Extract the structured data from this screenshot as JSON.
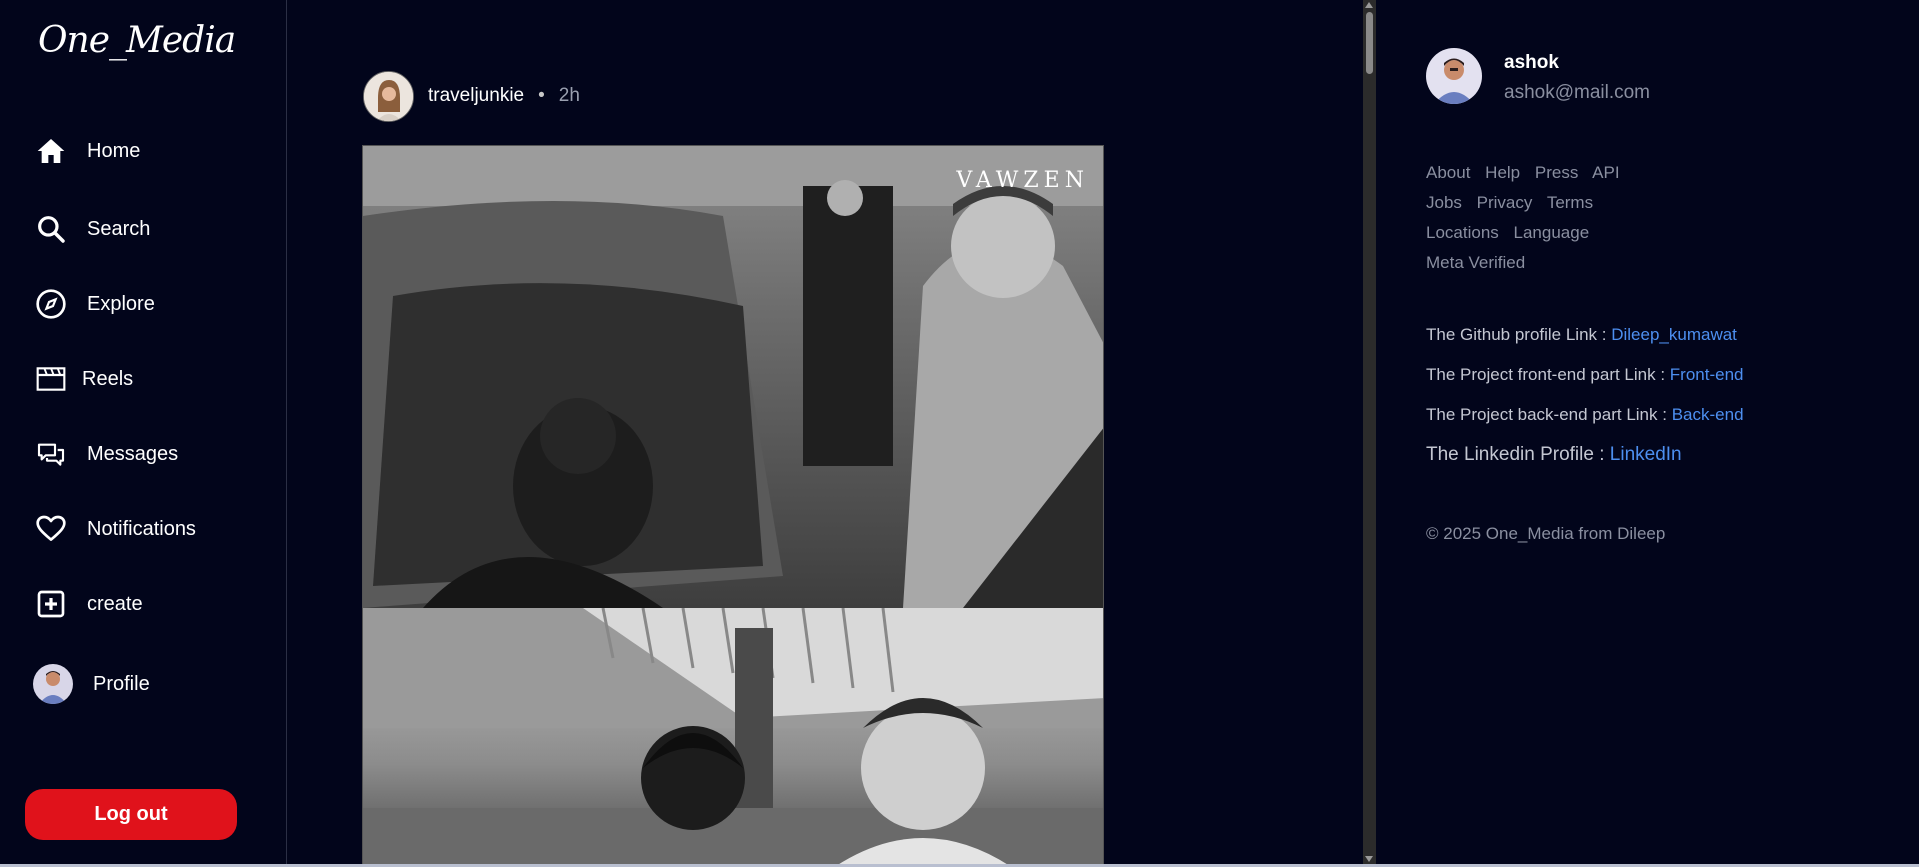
{
  "app": {
    "logo": "One_Media"
  },
  "sidebar": {
    "items": [
      {
        "label": "Home",
        "icon": "home-icon"
      },
      {
        "label": "Search",
        "icon": "search-icon"
      },
      {
        "label": "Explore",
        "icon": "compass-icon"
      },
      {
        "label": "Reels",
        "icon": "clapperboard-icon"
      },
      {
        "label": "Messages",
        "icon": "chat-bubbles-icon"
      },
      {
        "label": "Notifications",
        "icon": "heart-icon"
      },
      {
        "label": "create",
        "icon": "plus-square-icon"
      },
      {
        "label": "Profile",
        "icon": "avatar"
      }
    ],
    "logout_label": "Log out"
  },
  "post": {
    "username": "traveljunkie",
    "separator": "•",
    "time": "2h",
    "watermark": "VAWZEN"
  },
  "profile": {
    "username": "ashok",
    "email": "ashok@mail.com"
  },
  "footer_links": {
    "row1": [
      "About",
      "Help",
      "Press",
      "API"
    ],
    "row2": [
      "Jobs",
      "Privacy",
      "Terms"
    ],
    "row3": [
      "Locations",
      "Language"
    ],
    "row4": [
      "Meta Verified"
    ]
  },
  "project_links": {
    "github_text": "The Github profile Link :",
    "github_link": "Dileep_kumawat",
    "frontend_text": "The Project front-end part Link :",
    "frontend_link": "Front-end",
    "backend_text": "The Project back-end part Link :",
    "backend_link": "Back-end",
    "linkedin_text": "The Linkedin Profile :",
    "linkedin_link": "LinkedIn"
  },
  "copyright": "© 2025 One_Media from Dileep",
  "colors": {
    "background": "#02051b",
    "accent_link": "#4d8ff0",
    "logout": "#e0121b",
    "muted_text": "#8a8fa0"
  }
}
